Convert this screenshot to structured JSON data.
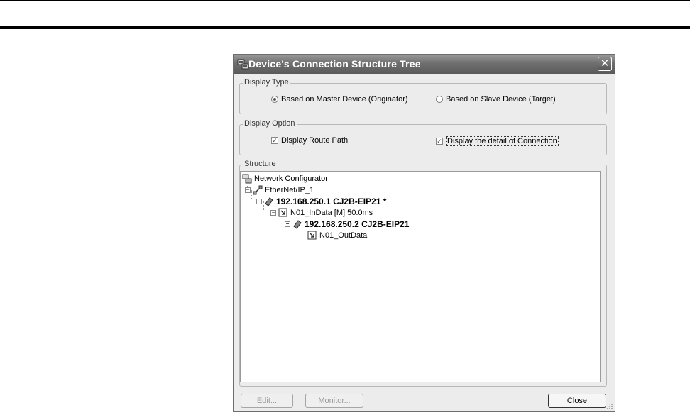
{
  "dialog": {
    "title": "Device's Connection Structure Tree",
    "close_symbol": "✕"
  },
  "display_type": {
    "legend": "Display Type",
    "options": [
      {
        "label": "Based on Master Device (Originator)",
        "selected": true
      },
      {
        "label": "Based on Slave Device (Target)",
        "selected": false
      }
    ]
  },
  "display_option": {
    "legend": "Display Option",
    "options": [
      {
        "label": "Display Route Path",
        "checked": true
      },
      {
        "label": "Display the detail of Connection",
        "checked": true
      }
    ]
  },
  "structure": {
    "legend": "Structure",
    "nodes": [
      {
        "label": "Network Configurator",
        "icon": "network-configurator-icon"
      },
      {
        "label": "EtherNet/IP_1",
        "icon": "ethernet-network-icon"
      },
      {
        "label": "192.168.250.1 CJ2B-EIP21 *",
        "icon": "device-icon"
      },
      {
        "label": "N01_InData [M] 50.0ms",
        "icon": "tag-set-icon"
      },
      {
        "label": "192.168.250.2 CJ2B-EIP21",
        "icon": "device-icon"
      },
      {
        "label": "N01_OutData",
        "icon": "tag-set-icon"
      }
    ]
  },
  "buttons": {
    "edit_prefix": "E",
    "edit_rest": "dit...",
    "monitor_prefix": "M",
    "monitor_rest": "onitor...",
    "close_prefix": "C",
    "close_rest": "lose"
  }
}
